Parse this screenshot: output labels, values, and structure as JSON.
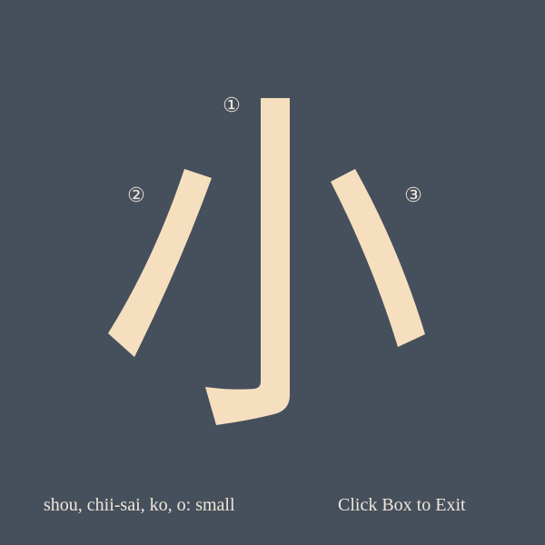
{
  "colors": {
    "background": "#46505c",
    "glyph": "#f6dfbf",
    "text": "#f0e6da"
  },
  "kanji": {
    "stroke_count": 3,
    "stroke_numbers": [
      "①",
      "②",
      "③"
    ]
  },
  "footer": {
    "reading": "shou, chii-sai, ko, o: small",
    "exit_label": "Click Box to Exit"
  }
}
